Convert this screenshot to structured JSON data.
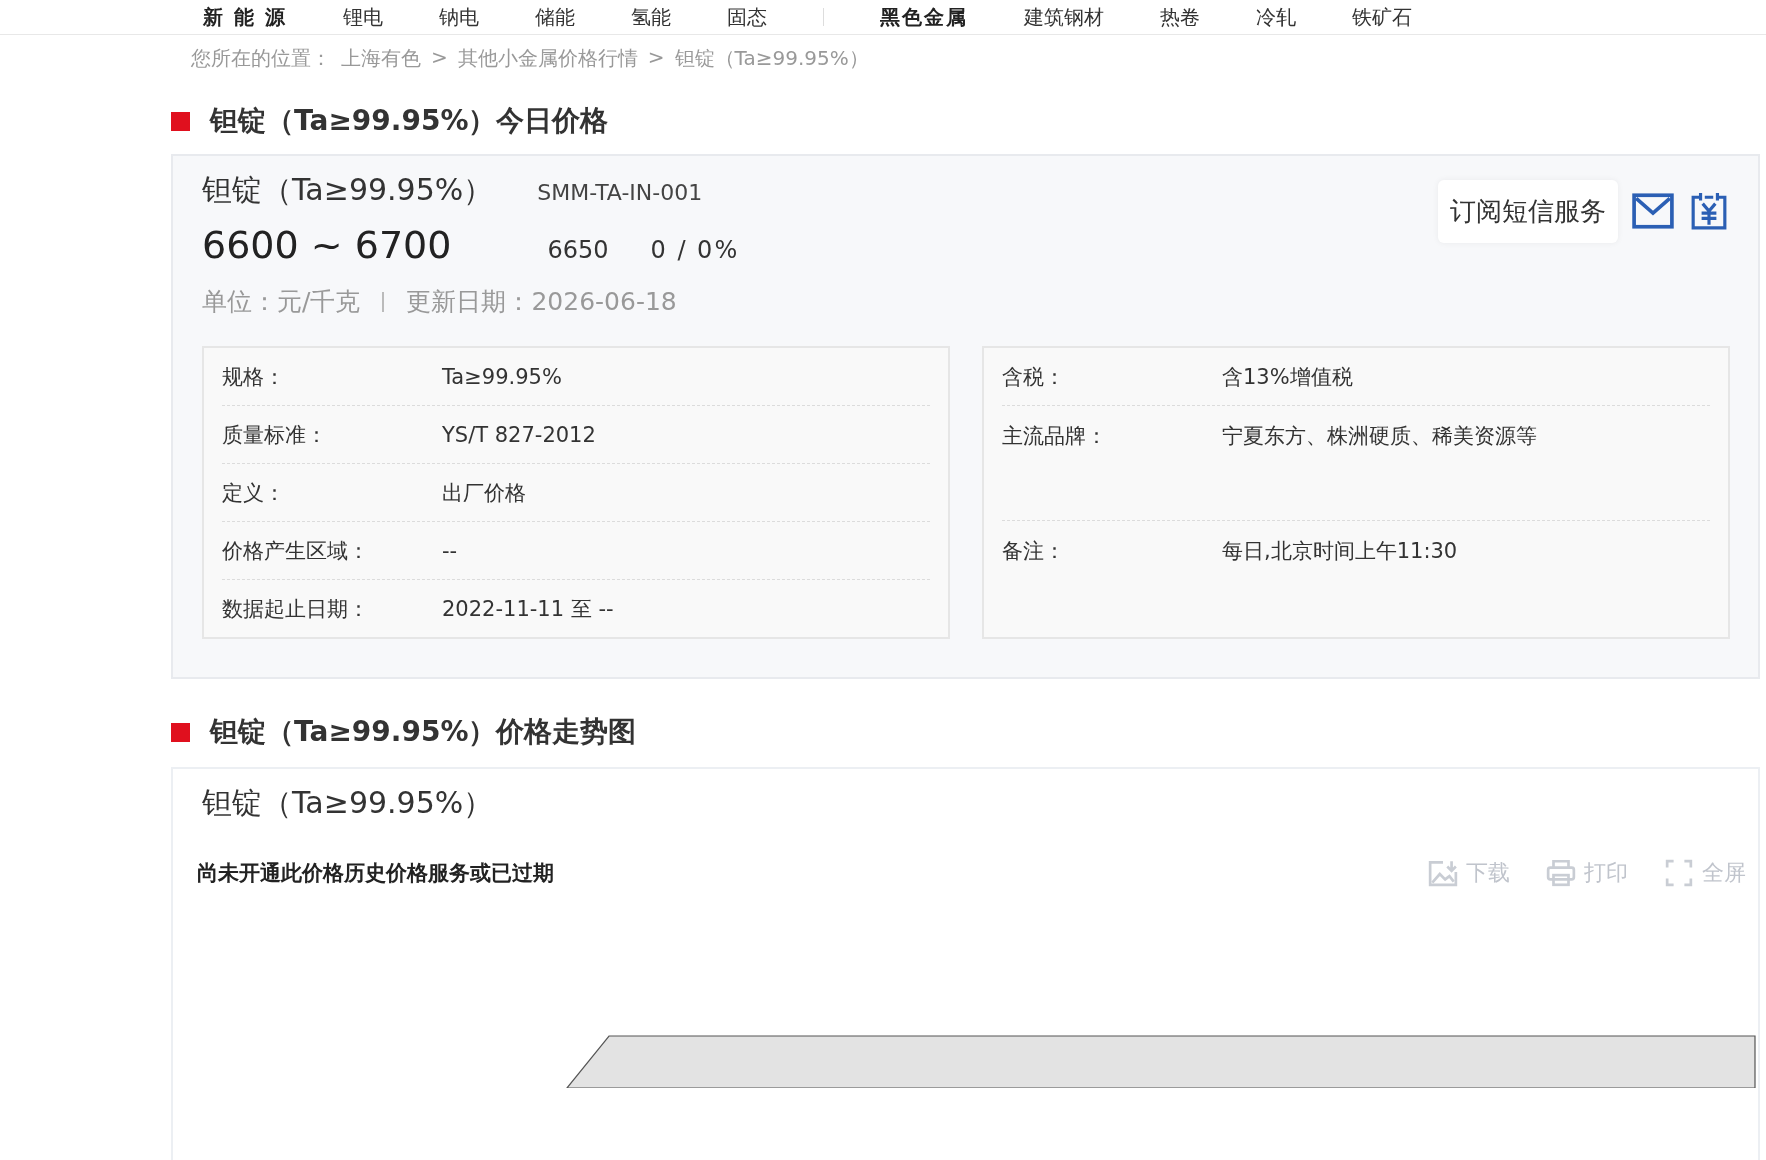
{
  "nav": [
    {
      "label": "新 能 源",
      "kind": "group"
    },
    {
      "label": "锂电",
      "kind": "item"
    },
    {
      "label": "钠电",
      "kind": "item"
    },
    {
      "label": "储能",
      "kind": "item"
    },
    {
      "label": "氢能",
      "kind": "item"
    },
    {
      "label": "固态",
      "kind": "item"
    },
    {
      "label": "黑色金属",
      "kind": "group"
    },
    {
      "label": "建筑钢材",
      "kind": "item"
    },
    {
      "label": "热卷",
      "kind": "item"
    },
    {
      "label": "冷轧",
      "kind": "item"
    },
    {
      "label": "铁矿石",
      "kind": "item"
    }
  ],
  "breadcrumb": {
    "prefix": "您所在的位置：",
    "items": [
      "上海有色",
      "其他小金属价格行情",
      "钽锭（Ta≥99.95%）"
    ],
    "separator": ">"
  },
  "price_section": {
    "title": "钽锭（Ta≥99.95%）今日价格",
    "name": "钽锭（Ta≥99.95%）",
    "code": "SMM-TA-IN-001",
    "range": "6600 ~ 6700",
    "average": "6650",
    "change": "0 / 0%",
    "unit": "单位：元/千克",
    "updated": "更新日期：2026-06-18",
    "subscribe": "订阅短信服务",
    "left_rows": [
      {
        "label": "规格：",
        "value": "Ta≥99.95%"
      },
      {
        "label": "质量标准：",
        "value": "YS/T 827-2012"
      },
      {
        "label": "定义：",
        "value": "出厂价格"
      },
      {
        "label": "价格产生区域：",
        "value": "--"
      },
      {
        "label": "数据起止日期：",
        "value": "2022-11-11 至 --"
      }
    ],
    "right_rows": [
      {
        "label": "含税：",
        "value": "含13%增值税",
        "kind": "single"
      },
      {
        "label": "主流品牌：",
        "value": "宁夏东方、株洲硬质、稀美资源等",
        "kind": "double"
      },
      {
        "label": "备注：",
        "value": "每日,北京时间上午11:30",
        "kind": "last"
      }
    ]
  },
  "trend_section": {
    "title": "钽锭（Ta≥99.95%）价格走势图",
    "name": "钽锭（Ta≥99.95%）",
    "notice": "尚未开通此价格历史价格服务或已过期",
    "tools": [
      {
        "label": "下载",
        "kind": "download"
      },
      {
        "label": "打印",
        "kind": "print"
      },
      {
        "label": "全屏",
        "kind": "fullscreen"
      }
    ]
  }
}
